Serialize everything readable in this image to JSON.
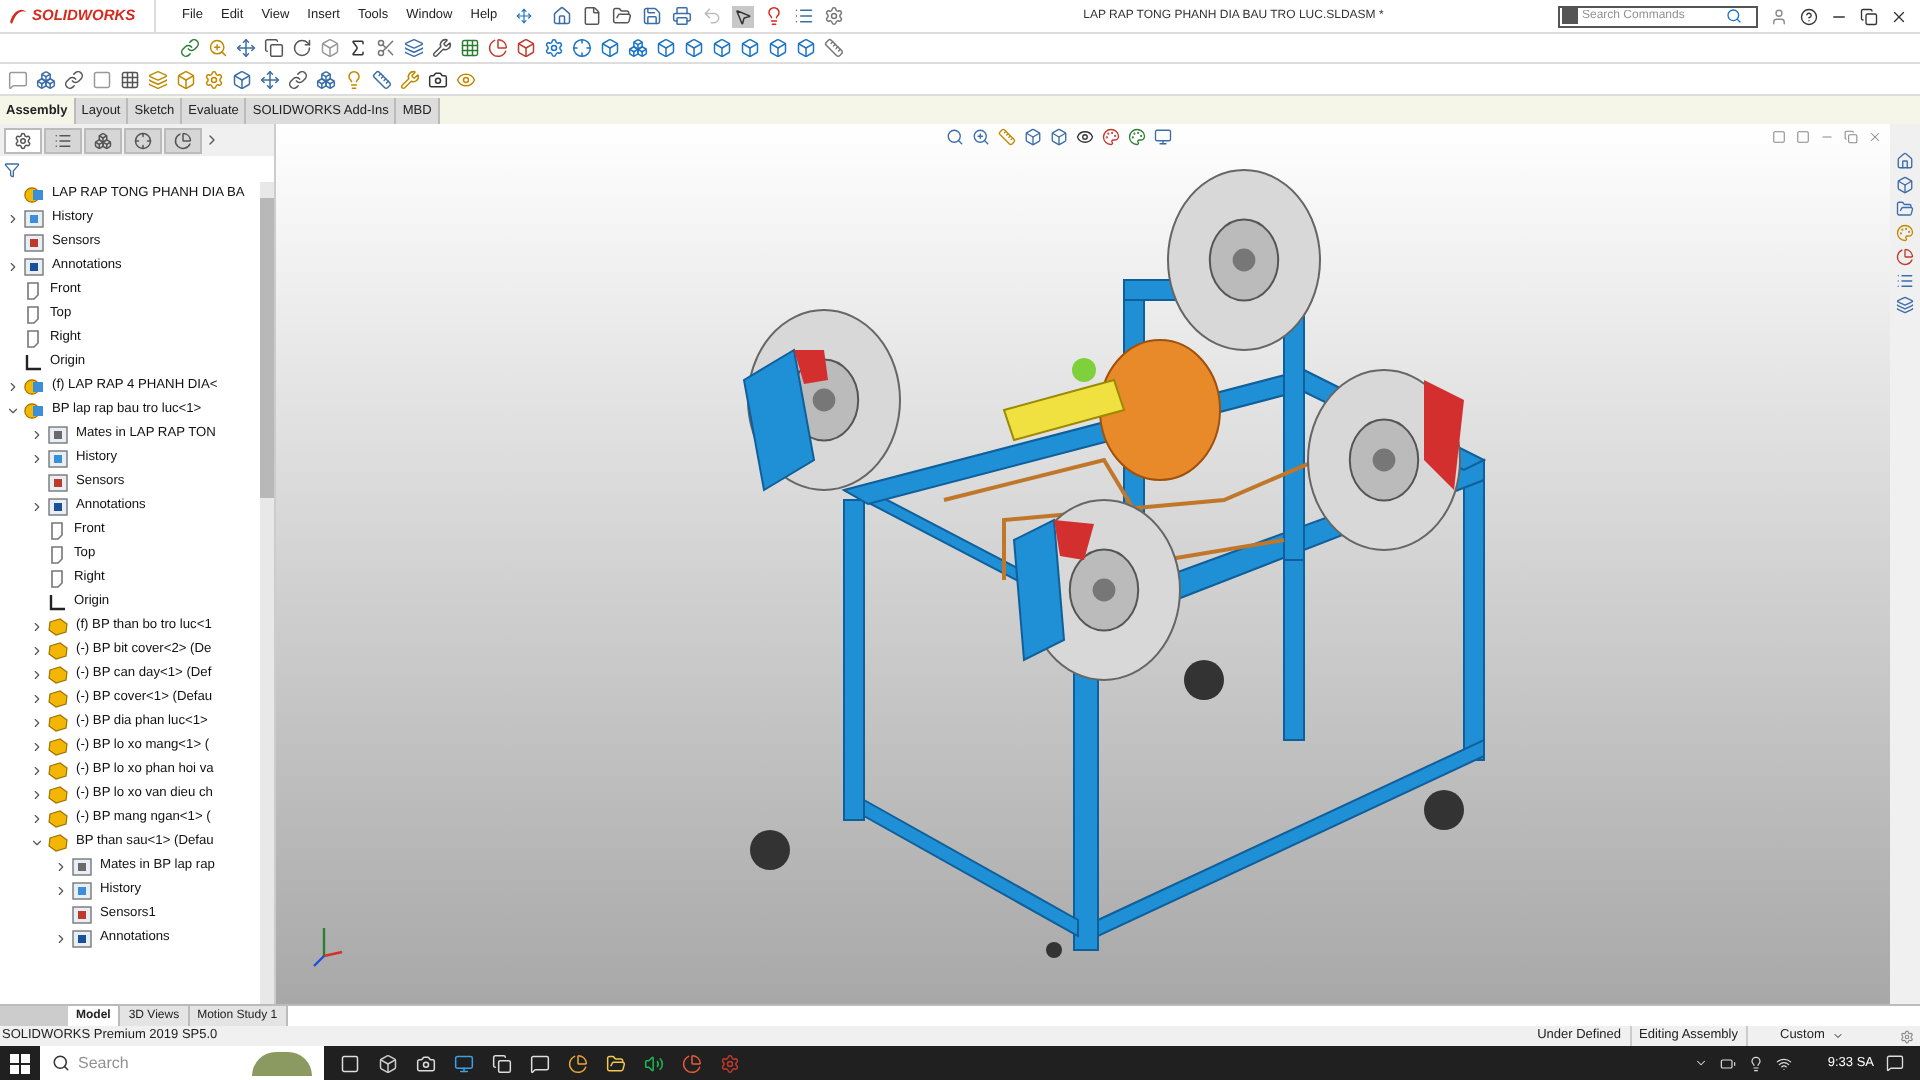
{
  "app": {
    "logo": "SOLIDWORKS",
    "menu": [
      "File",
      "Edit",
      "View",
      "Insert",
      "Tools",
      "Window",
      "Help"
    ],
    "title": "LAP RAP TONG PHANH DIA BAU TRO LUC.SLDASM *",
    "search": {
      "placeholder": "Search Commands"
    }
  },
  "command_tabs": [
    {
      "label": "Assembly",
      "selected": true
    },
    {
      "label": "Layout",
      "selected": false
    },
    {
      "label": "Sketch",
      "selected": false
    },
    {
      "label": "Evaluate",
      "selected": false
    },
    {
      "label": "SOLIDWORKS Add-Ins",
      "selected": false
    },
    {
      "label": "MBD",
      "selected": false
    }
  ],
  "panel_tabs": [
    {
      "selected": true
    },
    {
      "selected": false
    },
    {
      "selected": false
    },
    {
      "selected": false
    },
    {
      "selected": false
    }
  ],
  "tree": [
    {
      "label": "LAP RAP TONG PHANH DIA BA",
      "kind": "assembly",
      "children": [
        {
          "label": "History",
          "kind": "history",
          "expanded": false
        },
        {
          "label": "Sensors",
          "kind": "sensors"
        },
        {
          "label": "Annotations",
          "kind": "annotations",
          "expanded": false
        },
        {
          "label": "Front",
          "kind": "plane"
        },
        {
          "label": "Top",
          "kind": "plane"
        },
        {
          "label": "Right",
          "kind": "plane"
        },
        {
          "label": "Origin",
          "kind": "origin"
        },
        {
          "label": "(f) LAP RAP 4 PHANH DIA<",
          "kind": "assembly",
          "expanded": false
        },
        {
          "label": "BP lap rap bau tro luc<1>",
          "kind": "assembly",
          "expanded": true,
          "children": [
            {
              "label": "Mates in LAP RAP TON",
              "kind": "mates",
              "expanded": false
            },
            {
              "label": "History",
              "kind": "history",
              "expanded": false
            },
            {
              "label": "Sensors",
              "kind": "sensors"
            },
            {
              "label": "Annotations",
              "kind": "annotations",
              "expanded": false
            },
            {
              "label": "Front",
              "kind": "plane"
            },
            {
              "label": "Top",
              "kind": "plane"
            },
            {
              "label": "Right",
              "kind": "plane"
            },
            {
              "label": "Origin",
              "kind": "origin"
            },
            {
              "label": "(f) BP than bo tro luc<1",
              "kind": "part",
              "expanded": false
            },
            {
              "label": "(-) BP bit cover<2> (De",
              "kind": "part",
              "expanded": false
            },
            {
              "label": "(-) BP can day<1> (Def",
              "kind": "part",
              "expanded": false
            },
            {
              "label": "(-) BP cover<1> (Defau",
              "kind": "part",
              "expanded": false
            },
            {
              "label": "(-) BP dia phan luc<1>",
              "kind": "part",
              "expanded": false
            },
            {
              "label": "(-) BP lo xo mang<1> (",
              "kind": "part",
              "expanded": false
            },
            {
              "label": "(-) BP lo xo phan hoi va",
              "kind": "part",
              "expanded": false
            },
            {
              "label": "(-) BP lo xo van dieu ch",
              "kind": "part",
              "expanded": false
            },
            {
              "label": "(-) BP mang ngan<1> (",
              "kind": "part",
              "expanded": false
            },
            {
              "label": "BP than sau<1> (Defau",
              "kind": "part",
              "expanded": true,
              "children": [
                {
                  "label": "Mates in BP lap rap",
                  "kind": "mates",
                  "expanded": false
                },
                {
                  "label": "History",
                  "kind": "history",
                  "expanded": false
                },
                {
                  "label": "Sensors1",
                  "kind": "sensors"
                },
                {
                  "label": "Annotations",
                  "kind": "annotations",
                  "expanded": false
                }
              ]
            }
          ]
        }
      ]
    }
  ],
  "bottom_tabs": [
    {
      "label": "Model",
      "selected": true
    },
    {
      "label": "3D Views",
      "selected": false
    },
    {
      "label": "Motion Study 1",
      "selected": false
    }
  ],
  "status_bar": {
    "version": "SOLIDWORKS Premium 2019 SP5.0",
    "state": "Under Defined",
    "mode": "Editing Assembly",
    "units": "Custom"
  },
  "taskbar": {
    "search": {
      "placeholder": "Search"
    },
    "time": "9:33 SA"
  }
}
